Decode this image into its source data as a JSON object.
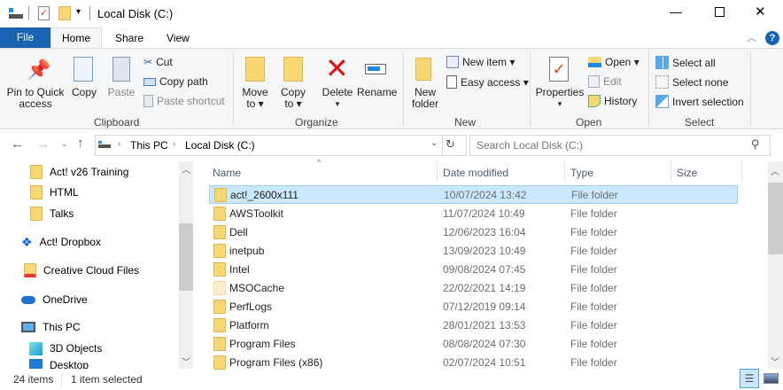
{
  "window": {
    "title": "Local Disk (C:)",
    "minimize": "—",
    "maximize": "☐",
    "close": "✕"
  },
  "tabs": [
    {
      "label": "File"
    },
    {
      "label": "Home"
    },
    {
      "label": "Share"
    },
    {
      "label": "View"
    }
  ],
  "ribbon": {
    "clipboard": {
      "label": "Clipboard",
      "pin": "Pin to Quick access",
      "pin1": "Pin to Quick",
      "pin2": "access",
      "copy": "Copy",
      "paste": "Paste",
      "cut": "Cut",
      "copy_path": "Copy path",
      "paste_shortcut": "Paste shortcut"
    },
    "organize": {
      "label": "Organize",
      "move1": "Move",
      "move2": "to ▾",
      "copy1": "Copy",
      "copy2": "to ▾",
      "delete": "Delete",
      "delete_arrow": "▾",
      "rename": "Rename"
    },
    "new": {
      "label": "New",
      "new_folder1": "New",
      "new_folder2": "folder",
      "new_item": "New item ▾",
      "easy_access": "Easy access ▾"
    },
    "open": {
      "label": "Open",
      "properties": "Properties",
      "properties_arrow": "▾",
      "open": "Open ▾",
      "edit": "Edit",
      "history": "History"
    },
    "select": {
      "label": "Select",
      "select_all": "Select all",
      "select_none": "Select none",
      "invert": "Invert selection"
    }
  },
  "address": {
    "crumbs": [
      "This PC",
      "Local Disk (C:)"
    ],
    "search_placeholder": "Search Local Disk (C:)"
  },
  "nav": [
    {
      "label": "Act! v26 Training",
      "icon": "folder-icon"
    },
    {
      "label": "HTML",
      "icon": "folder-icon"
    },
    {
      "label": "Talks",
      "icon": "folder-icon"
    },
    {
      "label": "Act! Dropbox",
      "icon": "dropbox-icon"
    },
    {
      "label": "Creative Cloud Files",
      "icon": "creative-cloud-icon"
    },
    {
      "label": "OneDrive",
      "icon": "onedrive-icon"
    },
    {
      "label": "This PC",
      "icon": "computer-icon"
    },
    {
      "label": "3D Objects",
      "icon": "3d-objects-icon"
    },
    {
      "label": "Desktop",
      "icon": "desktop-icon"
    }
  ],
  "columns": [
    "Name",
    "Date modified",
    "Type",
    "Size"
  ],
  "files": [
    {
      "name": "act!_2600x111",
      "date": "10/07/2024 13:42",
      "type": "File folder",
      "selected": true
    },
    {
      "name": "AWSToolkit",
      "date": "11/07/2024 10:49",
      "type": "File folder"
    },
    {
      "name": "Dell",
      "date": "12/06/2023 16:04",
      "type": "File folder"
    },
    {
      "name": "inetpub",
      "date": "13/09/2023 10:49",
      "type": "File folder"
    },
    {
      "name": "Intel",
      "date": "09/08/2024 07:45",
      "type": "File folder"
    },
    {
      "name": "MSOCache",
      "date": "22/02/2021 14:19",
      "type": "File folder",
      "hidden": true
    },
    {
      "name": "PerfLogs",
      "date": "07/12/2019 09:14",
      "type": "File folder"
    },
    {
      "name": "Platform",
      "date": "28/01/2021 13:53",
      "type": "File folder"
    },
    {
      "name": "Program Files",
      "date": "08/08/2024 07:30",
      "type": "File folder"
    },
    {
      "name": "Program Files (x86)",
      "date": "02/07/2024 10:51",
      "type": "File folder"
    }
  ],
  "status": {
    "count": "24 items",
    "selected": "1 item selected"
  },
  "colors": {
    "accent": "#0063b1",
    "selection": "#cce8ff",
    "selection_border": "#99d1ff"
  }
}
